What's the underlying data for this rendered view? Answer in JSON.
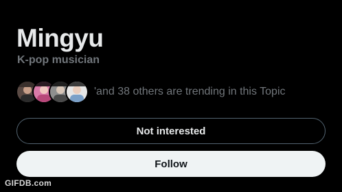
{
  "topic": {
    "title": "Mingyu",
    "subtitle": "K-pop musician",
    "trending_text": "'and 38 others are trending in this Topic"
  },
  "avatars": [
    {
      "icon": "user-avatar-icon"
    },
    {
      "icon": "user-avatar-icon"
    },
    {
      "icon": "user-avatar-icon"
    },
    {
      "icon": "user-avatar-icon"
    }
  ],
  "actions": {
    "not_interested_label": "Not interested",
    "follow_label": "Follow"
  },
  "watermark": "GIFDB.com",
  "colors": {
    "background": "#000000",
    "title": "#e7e9ea",
    "secondary_text": "#71767b",
    "outline_border": "#536471",
    "follow_bg": "#eff3f4",
    "follow_text": "#0f1419"
  }
}
